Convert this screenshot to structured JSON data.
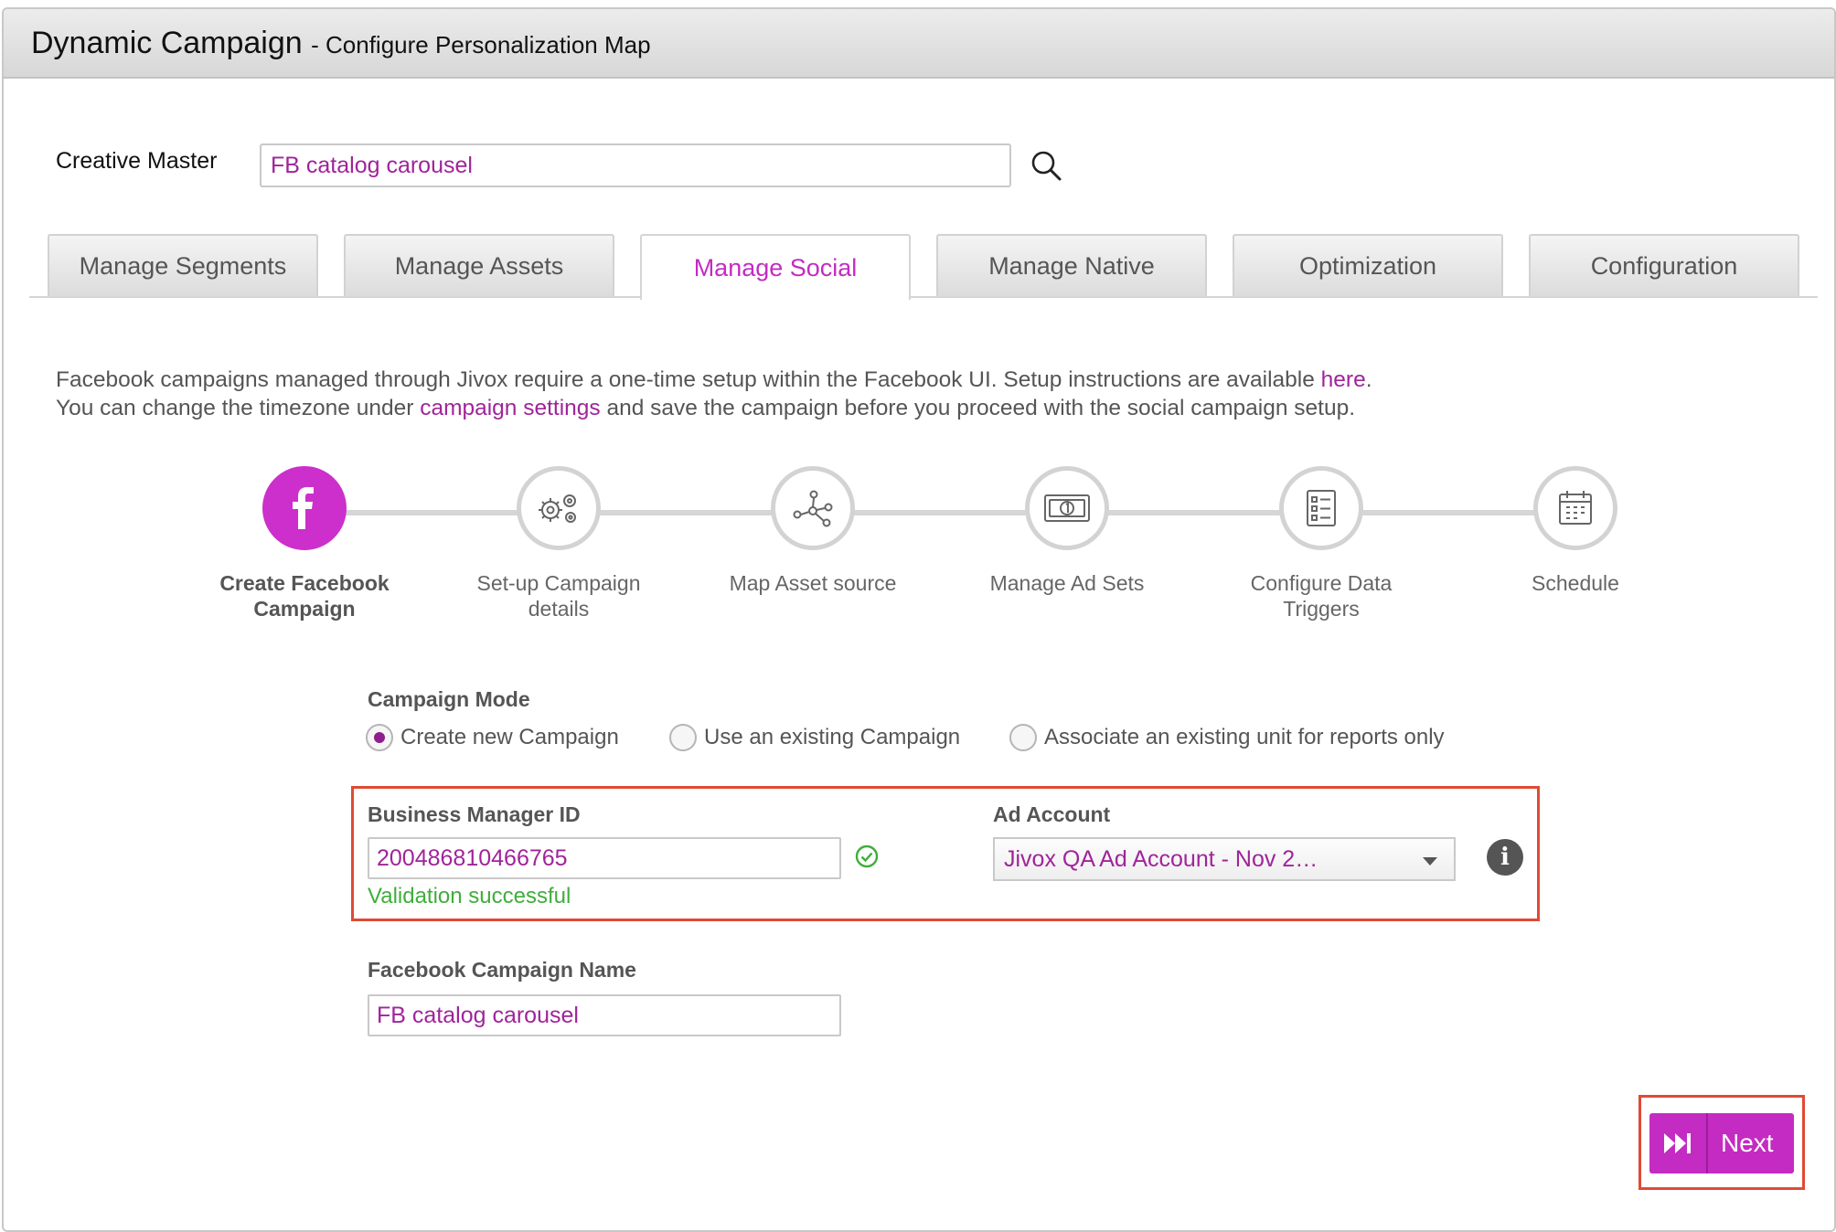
{
  "window": {
    "title": "Dynamic Campaign",
    "subtitle": "- Configure Personalization Map"
  },
  "creative_master": {
    "label": "Creative Master",
    "value": "FB catalog carousel"
  },
  "tabs": [
    {
      "label": "Manage Segments",
      "active": false
    },
    {
      "label": "Manage Assets",
      "active": false
    },
    {
      "label": "Manage Social",
      "active": true
    },
    {
      "label": "Manage Native",
      "active": false
    },
    {
      "label": "Optimization",
      "active": false
    },
    {
      "label": "Configuration",
      "active": false
    }
  ],
  "info": {
    "line1_pre": "Facebook campaigns managed through Jivox require a one-time setup within the Facebook UI. Setup instructions are available ",
    "line1_link": "here",
    "line1_post": ".",
    "line2_pre": "You can change the timezone under ",
    "line2_link": "campaign settings",
    "line2_post": " and save the campaign before you proceed with the social campaign setup."
  },
  "steps": [
    {
      "label_line1": "Create Facebook",
      "label_line2": "Campaign",
      "icon": "facebook-icon",
      "active": true
    },
    {
      "label_line1": "Set-up Campaign",
      "label_line2": "details",
      "icon": "gears-icon",
      "active": false
    },
    {
      "label_line1": "Map Asset source",
      "label_line2": "",
      "icon": "network-icon",
      "active": false
    },
    {
      "label_line1": "Manage Ad Sets",
      "label_line2": "",
      "icon": "money-icon",
      "active": false
    },
    {
      "label_line1": "Configure Data",
      "label_line2": "Triggers",
      "icon": "checklist-icon",
      "active": false
    },
    {
      "label_line1": "Schedule",
      "label_line2": "",
      "icon": "calendar-icon",
      "active": false
    }
  ],
  "campaign_mode": {
    "label": "Campaign Mode",
    "options": [
      {
        "label": "Create new Campaign",
        "checked": true
      },
      {
        "label": "Use an existing Campaign",
        "checked": false
      },
      {
        "label": "Associate an existing unit for reports only",
        "checked": false
      }
    ]
  },
  "business_manager": {
    "label": "Business Manager ID",
    "value": "200486810466765",
    "validation": "Validation successful"
  },
  "ad_account": {
    "label": "Ad Account",
    "selected": "Jivox QA Ad Account - Nov 2…"
  },
  "fb_campaign_name": {
    "label": "Facebook Campaign Name",
    "value": "FB catalog carousel"
  },
  "next_button": {
    "label": "Next"
  },
  "colors": {
    "accent": "#c42bc2",
    "link": "#a0249a",
    "success": "#3fae3a",
    "highlight_border": "#e04a35"
  }
}
